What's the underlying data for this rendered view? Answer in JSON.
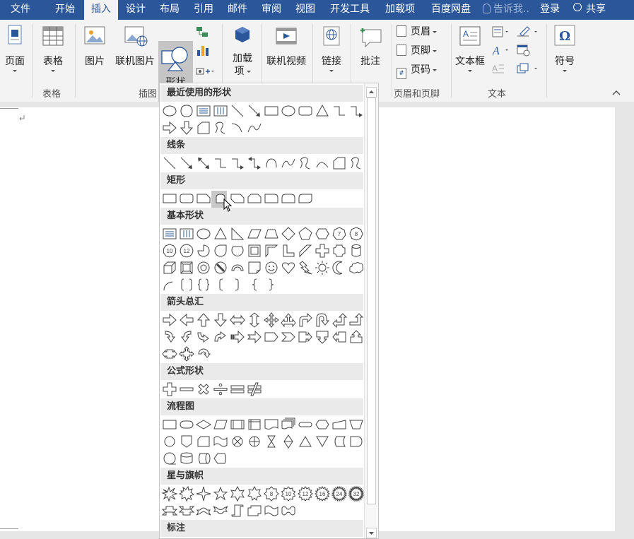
{
  "tabs": [
    {
      "id": "file",
      "label": "文件"
    },
    {
      "id": "home",
      "label": "开始"
    },
    {
      "id": "insert",
      "label": "插入",
      "active": true
    },
    {
      "id": "design",
      "label": "设计"
    },
    {
      "id": "layout",
      "label": "布局"
    },
    {
      "id": "references",
      "label": "引用"
    },
    {
      "id": "mailings",
      "label": "邮件"
    },
    {
      "id": "review",
      "label": "审阅"
    },
    {
      "id": "view",
      "label": "视图"
    },
    {
      "id": "developer",
      "label": "开发工具"
    },
    {
      "id": "addins",
      "label": "加载项"
    },
    {
      "id": "baidu",
      "label": "百度网盘"
    }
  ],
  "tell_me": "告诉我..",
  "login": "登录",
  "share": "共享",
  "ribbon": {
    "pages_label": "页面",
    "table_label": "表格",
    "table_group": "表格",
    "picture_label": "图片",
    "online_picture_label": "联机图片",
    "shapes_label": "形状",
    "illustrations_group": "插图",
    "addins_label_1": "加载",
    "addins_label_2": "项",
    "online_video_label": "联机视频",
    "link_label": "链接",
    "comment_label": "批注",
    "header_label": "页眉",
    "footer_label": "页脚",
    "page_number_label": "页码",
    "header_footer_group": "页眉和页脚",
    "textbox_label": "文本框",
    "text_group": "文本",
    "symbol_label": "符号"
  },
  "shapes_panel": {
    "sections": {
      "recent": "最近使用的形状",
      "lines": "线条",
      "rectangles": "矩形",
      "basic": "基本形状",
      "arrows": "箭头总汇",
      "equation": "公式形状",
      "flowchart": "流程图",
      "stars": "星与旗帜",
      "callouts": "标注"
    },
    "star_numbers": [
      "8",
      "10",
      "12",
      "16",
      "24",
      "32"
    ],
    "basic_numbers": [
      "7",
      "8",
      "10",
      "12"
    ],
    "highlighted_shape": "snip-round-rectangle"
  },
  "colors": {
    "accent": "#2b579a",
    "ribbon": "#f3f3f3",
    "section": "#eaeaea"
  }
}
